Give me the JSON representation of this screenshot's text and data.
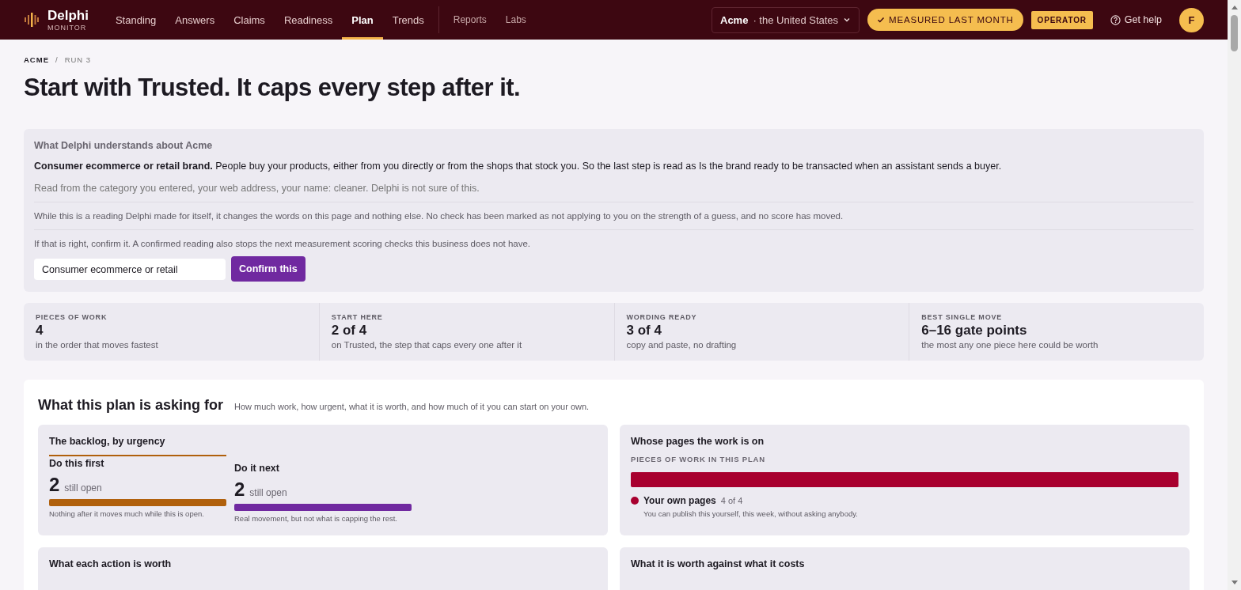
{
  "brand": {
    "name": "Delphi",
    "subtitle": "MONITOR"
  },
  "nav": [
    {
      "label": "Standing",
      "selected": false
    },
    {
      "label": "Answers",
      "selected": false
    },
    {
      "label": "Claims",
      "selected": false
    },
    {
      "label": "Readiness",
      "selected": false
    },
    {
      "label": "Plan",
      "selected": true
    },
    {
      "label": "Trends",
      "selected": false
    }
  ],
  "nav_secondary": [
    {
      "label": "Reports",
      "selected": false
    },
    {
      "label": "Labs",
      "selected": false
    }
  ],
  "account": {
    "name": "Acme",
    "region": "· the United States"
  },
  "status_pill": "MEASURED LAST MONTH",
  "role_badge": "OPERATOR",
  "help": "Get help",
  "avatar": "F",
  "breadcrumb": [
    "ACME",
    "/",
    "RUN 3"
  ],
  "title": "Start with Trusted. It caps every step after it.",
  "understanding": {
    "heading": "What Delphi understands about Acme",
    "summary": "**Consumer ecommerce or retail brand.** People buy your products, either from you directly or from the shops that stock you. So the last step is read as Is the brand ready to be transacted when an assistant sends a buyer.",
    "source": "Read from the category you entered, your web address, your name: cleaner. Delphi is not sure of this.",
    "notes": [
      "While this is a reading Delphi made for itself, it changes the words on this page and nothing else. No check has been marked as not applying to you on the strength of a guess, and no score has moved.",
      "If that is right, confirm it. A confirmed reading also stops the next measurement scoring checks this business does not have."
    ],
    "field_value": "Consumer ecommerce or retail",
    "confirm_button": "Confirm this"
  },
  "stats": [
    {
      "label": "PIECES OF WORK",
      "value": "4",
      "note": "in the order that moves fastest"
    },
    {
      "label": "START HERE",
      "value": "2 of 4",
      "note": "on Trusted, the step that caps every one after it"
    },
    {
      "label": "WORDING READY",
      "value": "3 of 4",
      "note": "copy and paste, no drafting"
    },
    {
      "label": "BEST SINGLE MOVE",
      "value": "6–16 gate points",
      "note": "the most any one piece here could be worth"
    }
  ],
  "plan": {
    "title": "What this plan is asking for",
    "subtitle": "How much work, how urgent, what it is worth, and how much of it you can start on your own.",
    "backlog": {
      "title": "The backlog, by urgency",
      "groups": [
        {
          "label": "Do this first",
          "count": "2",
          "count_note": "still open",
          "level": 1,
          "color": "#b0600c",
          "note": "Nothing after it moves much while this is open.",
          "selected": true
        },
        {
          "label": "Do it next",
          "count": "2",
          "count_note": "still open",
          "level": 1,
          "color": "#7029a0",
          "note": "Real movement, but not what is capping the rest.",
          "selected": false
        }
      ]
    },
    "owners": {
      "title": "Whose pages the work is on",
      "label": "PIECES OF WORK IN THIS PLAN",
      "segments": [
        {
          "name": "Your own pages",
          "count": "4 of 4",
          "level": 1,
          "color": "#a8002f",
          "note": "You can publish this yourself, this week, without asking anybody."
        }
      ]
    },
    "more_cards": [
      "What each action is worth",
      "What it is worth against what it costs"
    ]
  }
}
